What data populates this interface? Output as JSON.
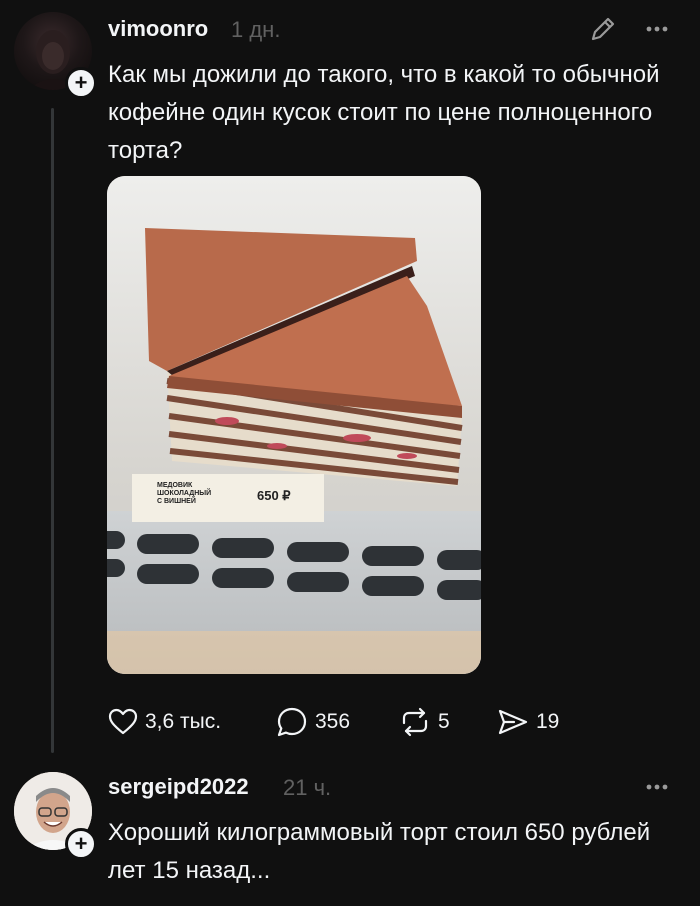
{
  "post": {
    "username": "vimoonro",
    "time": "1 дн.",
    "text": "Как мы дожили до такого, что в какой то обычной кофейне один кусок стоит по цене полноценного торта?",
    "photo": {
      "label_lines": [
        "МЕДОВИК",
        "ШОКОЛАДНЫЙ",
        "С ВИШНЕЙ"
      ],
      "price": "650 ₽"
    },
    "actions": {
      "likes": "3,6 тыс.",
      "replies": "356",
      "reposts": "5",
      "shares": "19"
    }
  },
  "reply": {
    "username": "sergeipd2022",
    "time": "21 ч.",
    "text": "Хороший килограммовый торт стоил 650 рублей лет 15 назад..."
  },
  "icons": [
    "edit-icon",
    "more-icon",
    "plus-icon",
    "heart-icon",
    "comment-icon",
    "repost-icon",
    "share-icon"
  ]
}
